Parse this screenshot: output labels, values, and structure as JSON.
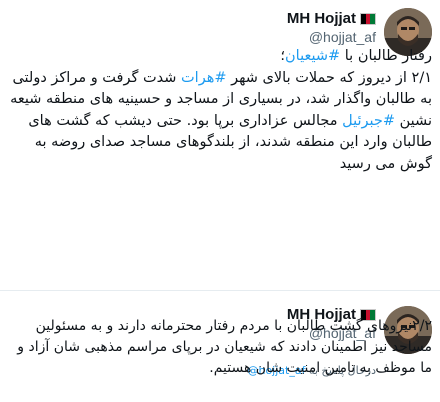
{
  "tweets": [
    {
      "author": {
        "name": "MH Hojjat",
        "handle": "@hojjat_af"
      },
      "icons": {
        "avatar": "profile-photo",
        "flag": "flag-icon"
      },
      "flag_colors": [
        "#000000",
        "#c8102e",
        "#007a36"
      ],
      "text": {
        "l1a": "رفتار طالبان با ",
        "l1tag": "#شیعیان",
        "l1b": "؛",
        "l2a": "۲/۱ از دیروز که حملات بالای شهر ",
        "l2tag": "#هرات",
        "l2b": " شدت گرفت و مراکز دولتی به طالبان واگذار شد، در بسیاری از مساجد و حسینیه های منطقه شیعه نشین ",
        "l2tag2": "#جبرئیل",
        "l2c": " مجالس عزاداری برپا بود. حتی دیشب که گشت های طالبان وارد این منطقه شدند، از بلندگوهای مساجد صدای روضه به گوش می رسید"
      }
    },
    {
      "author": {
        "name": "MH Hojjat",
        "handle": "@hojjat_af"
      },
      "icons": {
        "avatar": "profile-photo",
        "flag": "flag-icon"
      },
      "reply": {
        "prefix": "درحال پاسخ به ",
        "mention": "@hojjat_af"
      },
      "text": {
        "body": "۲/۲نیروهای گشت طالبان با مردم رفتار محترمانه دارند و به مسئولین مساجد نیز اطمینان دادند که شیعیان در برپای مراسم مذهبی شان آزاد و ما موظف به تامین امنیت شان هستیم."
      }
    }
  ]
}
